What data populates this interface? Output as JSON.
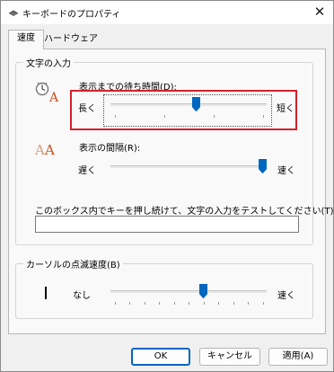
{
  "window": {
    "title": "キーボードのプロパティ",
    "close_glyph": "✕"
  },
  "tabs": [
    {
      "label": "速度",
      "active": true
    },
    {
      "label": "ハードウェア",
      "active": false
    }
  ],
  "character_repeat": {
    "group_label": "文字の入力",
    "delay": {
      "label": "表示までの待ち時間(D):",
      "min_label": "長く",
      "max_label": "短く",
      "value": 0.55,
      "ticks": 4
    },
    "rate": {
      "label": "表示の間隔(R):",
      "min_label": "遅く",
      "max_label": "速く",
      "value": 1.0
    },
    "test": {
      "label": "このボックス内でキーを押し続けて、文字の入力をテストしてください(T):",
      "value": ""
    }
  },
  "cursor_blink": {
    "group_label": "カーソルの点滅速度(B)",
    "min_label": "なし",
    "max_label": "速く",
    "value": 0.6,
    "ticks": 11
  },
  "buttons": {
    "ok": "OK",
    "cancel": "キャンセル",
    "apply": "適用(A)"
  },
  "colors": {
    "accent": "#0067c0",
    "highlight_box": "#d6202a"
  },
  "icons": {
    "app": "keyboard-icon",
    "delay": "clock-letter-a-icon",
    "rate": "repeated-letter-a-icon",
    "blink": "text-cursor-icon"
  }
}
